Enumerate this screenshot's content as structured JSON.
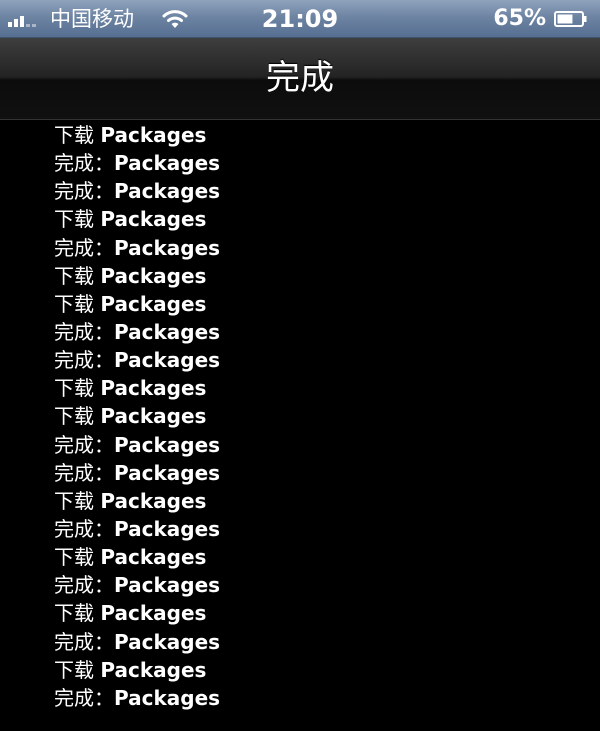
{
  "status_bar": {
    "carrier": "中国移动",
    "time": "21:09",
    "battery_percent": "65%",
    "battery_level": 0.65,
    "signal_bars_on": 3,
    "signal_bars_total": 5,
    "icons": [
      "signal-icon",
      "wifi-icon",
      "battery-icon"
    ]
  },
  "nav_bar": {
    "title": "完成"
  },
  "log": [
    {
      "prefix": "下载 ",
      "target": "Packages"
    },
    {
      "prefix": "完成：",
      "target": "Packages"
    },
    {
      "prefix": "完成：",
      "target": "Packages"
    },
    {
      "prefix": "下载 ",
      "target": "Packages"
    },
    {
      "prefix": "完成：",
      "target": "Packages"
    },
    {
      "prefix": "下载 ",
      "target": "Packages"
    },
    {
      "prefix": "下载 ",
      "target": "Packages"
    },
    {
      "prefix": "完成：",
      "target": "Packages"
    },
    {
      "prefix": "完成：",
      "target": "Packages"
    },
    {
      "prefix": "下载 ",
      "target": "Packages"
    },
    {
      "prefix": "下载 ",
      "target": "Packages"
    },
    {
      "prefix": "完成：",
      "target": "Packages"
    },
    {
      "prefix": "完成：",
      "target": "Packages"
    },
    {
      "prefix": "下载 ",
      "target": "Packages"
    },
    {
      "prefix": "完成：",
      "target": "Packages"
    },
    {
      "prefix": "下载 ",
      "target": "Packages"
    },
    {
      "prefix": "完成：",
      "target": "Packages"
    },
    {
      "prefix": "下载 ",
      "target": "Packages"
    },
    {
      "prefix": "完成：",
      "target": "Packages"
    },
    {
      "prefix": "下载 ",
      "target": "Packages"
    },
    {
      "prefix": "完成：",
      "target": "Packages"
    }
  ]
}
